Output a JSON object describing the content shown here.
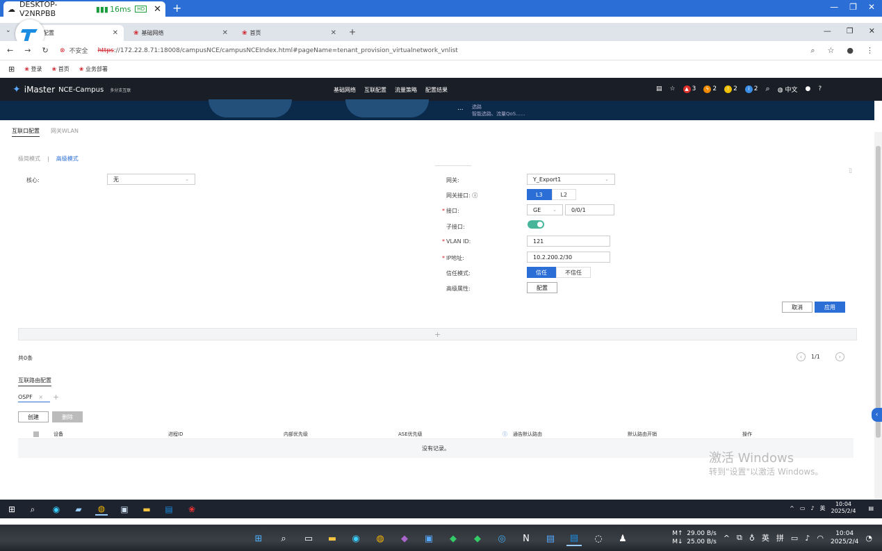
{
  "outer_tab": {
    "host": "DESKTOP-V2NRPBB",
    "ping": "16ms",
    "hd": "HD",
    "close": "✕",
    "new_tab": "+"
  },
  "browser": {
    "tabs": [
      {
        "label": "配置"
      },
      {
        "label": "基础网络"
      },
      {
        "label": "首页"
      }
    ],
    "new_tab": "+",
    "insecure_label": "不安全",
    "url_scheme": "https",
    "url_rest": "://172.22.8.71:18008/campusNCE/campusNCEIndex.html#pageName=tenant_provision_virtualnetwork_vnlist",
    "bookmarks": [
      "登录",
      "首页",
      "业务部署"
    ]
  },
  "app": {
    "brand": "iMaster",
    "product": "NCE-Campus",
    "subtitle": "多分支互联",
    "nav": [
      "基础网络",
      "互联配置",
      "流量策略",
      "配置结果"
    ],
    "alarms": [
      {
        "count": "3",
        "color": "#e0302a"
      },
      {
        "count": "2",
        "color": "#f08a00"
      },
      {
        "count": "2",
        "color": "#f0c000"
      },
      {
        "count": "2",
        "color": "#3a8ee6"
      }
    ],
    "lang": "中文"
  },
  "banner": {
    "ellipsis": "...",
    "line1": "选路",
    "line2": "智能选路、流量QoS......"
  },
  "page_tabs": {
    "active": "互联口配置",
    "inactive": "网关WLAN"
  },
  "modes": {
    "basic": "极简模式",
    "advanced": "高级模式"
  },
  "form_left": {
    "core_label": "核心:",
    "core_value": "无"
  },
  "form_right": {
    "gateway_label": "网关:",
    "gateway_value": "Y_Export1",
    "gw_iface_label": "网关接口:",
    "l3": "L3",
    "l2": "L2",
    "iface_label": "接口:",
    "iface_type": "GE",
    "iface_num": "0/0/1",
    "subiface_label": "子接口:",
    "vlan_label": "VLAN ID:",
    "vlan_value": "121",
    "ip_label": "IP地址:",
    "ip_value": "10.2.200.2/30",
    "trust_label": "信任模式:",
    "trust": "信任",
    "untrust": "不信任",
    "adv_label": "高级属性:",
    "adv_button": "配置"
  },
  "actions": {
    "cancel": "取消",
    "apply": "应用"
  },
  "list": {
    "add": "+",
    "total": "共0条",
    "page": "1/1"
  },
  "routing": {
    "title": "互联路由配置",
    "proto_tab": "OSPF",
    "proto_close": "×",
    "create": "创建",
    "delete": "删除",
    "columns": [
      "设备",
      "进程ID",
      "内部优先级",
      "ASE优先级",
      "通告默认路由",
      "默认路由开销",
      "操作"
    ],
    "empty": "没有记录。"
  },
  "watermark": {
    "line1": "激活 Windows",
    "line2": "转到\"设置\"以激活 Windows。"
  },
  "inner_tray": {
    "ime": "英",
    "time": "10:04",
    "date": "2025/2/4"
  },
  "outer_tray": {
    "up_label": "M↑",
    "up_speed": "29.00 B/s",
    "down_label": "M↓",
    "down_speed": "25.00 B/s",
    "ime1": "英",
    "ime2": "拼",
    "time": "10:04",
    "date": "2025/2/4"
  }
}
